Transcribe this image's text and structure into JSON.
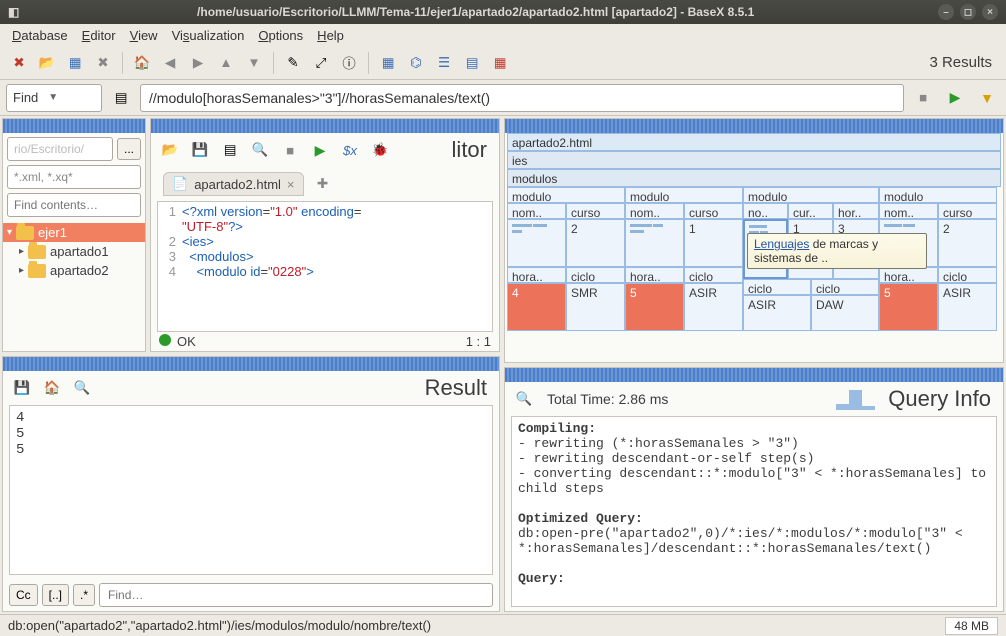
{
  "window": {
    "title": "/home/usuario/Escritorio/LLMM/Tema-11/ejer1/apartado2/apartado2.html [apartado2] - BaseX 8.5.1"
  },
  "menu": {
    "database": "Database",
    "editor": "Editor",
    "view": "View",
    "visualization": "Visualization",
    "options": "Options",
    "help": "Help"
  },
  "toolbar": {
    "results": "3 Results"
  },
  "querybar": {
    "mode": "Find",
    "query": "//modulo[horasSemanales>\"3\"]//horasSemanales/text()"
  },
  "filetree": {
    "path": "rio/Escritorio/",
    "browse": "...",
    "filter": "*.xml, *.xq*",
    "find": "Find contents…",
    "items": [
      {
        "name": "ejer1",
        "selected": true,
        "indent": 0
      },
      {
        "name": "apartado1",
        "indent": 1,
        "haschild": true
      },
      {
        "name": "apartado2",
        "indent": 1,
        "haschild": true
      }
    ]
  },
  "editor": {
    "title": "litor",
    "tab": "apartado2.html",
    "lines": [
      {
        "n": "1",
        "html": "<span class='kw'>&lt;?xml</span> <span class='kw'>version</span>=<span class='str'>\"1.0\"</span> <span class='kw'>encoding</span>="
      },
      {
        "n": "",
        "html": "<span class='str'>\"UTF-8\"</span><span class='kw'>?&gt;</span>"
      },
      {
        "n": "2",
        "html": "<span class='kw'>&lt;ies&gt;</span>"
      },
      {
        "n": "3",
        "html": "  <span class='kw'>&lt;modulos&gt;</span>"
      },
      {
        "n": "4",
        "html": "    <span class='kw'>&lt;modulo</span> <span class='kw'>id</span>=<span class='str'>\"0228\"</span><span class='kw'>&gt;</span>"
      }
    ],
    "status_ok": "OK",
    "status_pos": "1 : 1"
  },
  "result": {
    "title": "Result",
    "body": "4\n5\n5",
    "btn_cc": "Cc",
    "btn_brkt": "[..]",
    "btn_dot": ".*",
    "find": "Find…"
  },
  "treemap": {
    "root": "apartado2.html",
    "l1": "ies",
    "l2": "modulos",
    "mods": [
      "modulo",
      "modulo",
      "modulo",
      "modulo"
    ],
    "cols": {
      "nom": "nom..",
      "curso": "curso",
      "no": "no..",
      "cur": "cur..",
      "hor": "hor.."
    },
    "curso_vals": [
      "2",
      "1",
      "1",
      "3",
      "2"
    ],
    "hora": "hora..",
    "ciclo": "ciclo",
    "hora_vals": [
      "4",
      "5",
      "5"
    ],
    "ciclo_vals": [
      "SMR",
      "ASIR",
      "ASIR",
      "DAW",
      "ASIR"
    ],
    "tooltip": {
      "link": "Lenguajes",
      "rest": " de marcas y sistemas de .."
    }
  },
  "queryinfo": {
    "title": "Query Info",
    "time": "Total Time: 2.86 ms",
    "compiling_h": "Compiling:",
    "compiling": [
      "- rewriting (*:horasSemanales > \"3\")",
      "- rewriting descendant-or-self step(s)",
      "- converting descendant::*:modulo[\"3\" < *:horasSemanales] to child steps"
    ],
    "optq_h": "Optimized Query:",
    "optq": "db:open-pre(\"apartado2\",0)/*:ies/*:modulos/*:modulo[\"3\" < *:horasSemanales]/descendant::*:horasSemanales/text()",
    "query_h": "Query:"
  },
  "statusbar": {
    "path": "db:open(\"apartado2\",\"apartado2.html\")/ies/modulos/modulo/nombre/text()",
    "mem": "48 MB"
  }
}
